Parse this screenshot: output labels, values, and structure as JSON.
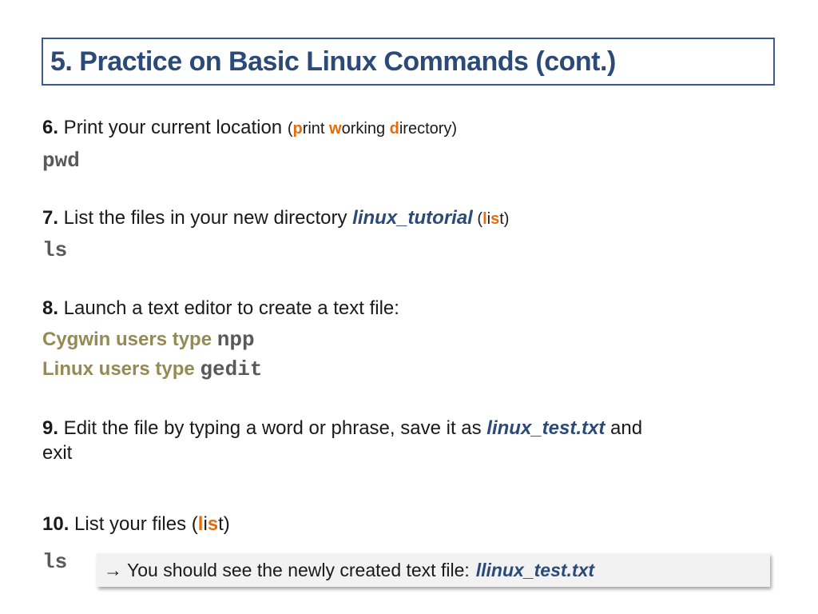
{
  "title": "5. Practice on Basic Linux Commands (cont.)",
  "steps": {
    "s6": {
      "num": "6.",
      "text": " Print your current location ",
      "paren_open": "(",
      "p_hl": "p",
      "p_rest": "rint ",
      "w_hl": "w",
      "w_rest": "orking ",
      "d_hl": "d",
      "d_rest": "irectory)",
      "command": "pwd"
    },
    "s7": {
      "num": "7.",
      "text": " List the files in your new directory ",
      "dir": "linux_tutorial",
      "paren_open": " (",
      "l_hl": "l",
      "i_part": "i",
      "s_hl": "s",
      "t_part": "t)",
      "command": "ls"
    },
    "s8": {
      "num": "8.",
      "text": " Launch a text editor to create a text file:",
      "cygwin_label": "Cygwin users type ",
      "cygwin_cmd": "npp",
      "linux_label": "Linux users type ",
      "linux_cmd": "gedit"
    },
    "s9": {
      "num": "9.",
      "text": " Edit the file by typing a word or phrase, save it as ",
      "file": "linux_test.txt",
      "after": " and",
      "line2": "exit"
    },
    "s10": {
      "num": "10.",
      "text": " List your files (",
      "l_hl": "l",
      "i_part": "i",
      "s_hl": "s",
      "t_part": "t)",
      "command": "ls"
    }
  },
  "note": {
    "arrow": "→",
    "text": "You should see the newly created text file:",
    "file": "llinux_test.txt"
  }
}
